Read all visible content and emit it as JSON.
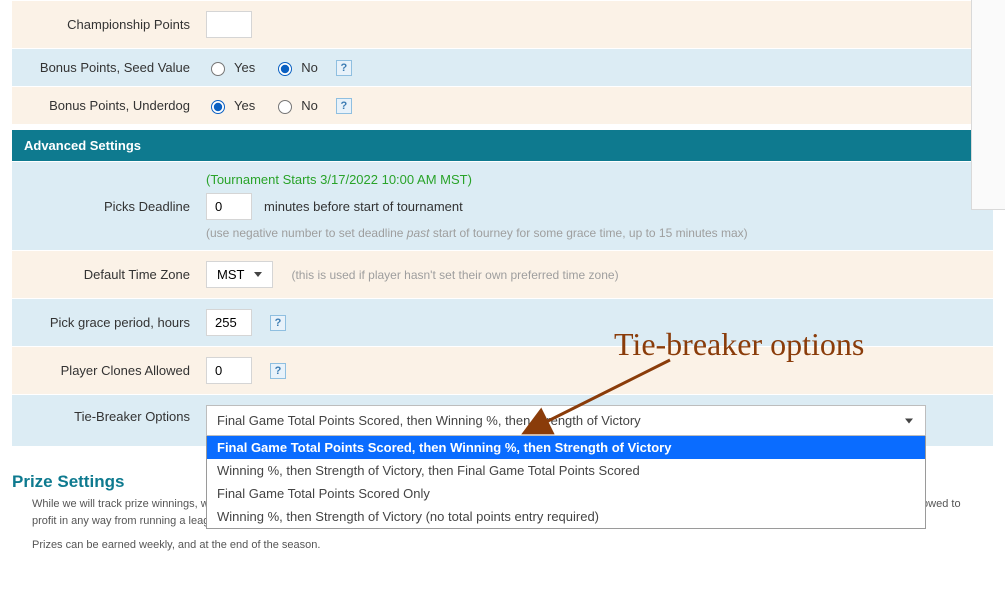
{
  "rows": {
    "championship_points": {
      "label": "Championship Points",
      "value": ""
    },
    "seed_bonus": {
      "label": "Bonus Points, Seed Value",
      "yes": "Yes",
      "no": "No"
    },
    "underdog_bonus": {
      "label": "Bonus Points, Underdog",
      "yes": "Yes",
      "no": "No"
    },
    "picks_deadline": {
      "label": "Picks Deadline",
      "note": "(Tournament Starts 3/17/2022 10:00 AM MST)",
      "value": "0",
      "suffix": "minutes before start of tournament",
      "hint_prefix": "(use negative number to set deadline ",
      "hint_em": "past",
      "hint_suffix": " start of tourney for some grace time, up to 15 minutes max)"
    },
    "default_tz": {
      "label": "Default Time Zone",
      "value": "MST",
      "hint": "(this is used if player hasn't set their own preferred time zone)"
    },
    "grace": {
      "label": "Pick grace period, hours",
      "value": "255"
    },
    "clones": {
      "label": "Player Clones Allowed",
      "value": "0"
    },
    "tiebreak": {
      "label": "Tie-Breaker Options",
      "selected": "Final Game Total Points Scored, then Winning %, then Strength of Victory",
      "options": [
        "Final Game Total Points Scored, then Winning %, then Strength of Victory",
        "Winning %, then Strength of Victory, then Final Game Total Points Scored",
        "Final Game Total Points Scored Only",
        "Winning %, then Strength of Victory (no total points entry required)"
      ]
    }
  },
  "section_advanced": "Advanced Settings",
  "prize": {
    "title": "Prize Settings",
    "line1": "While we will track prize winnings, we do not handle payment reception or distribution of prizes for your league. It is up to you to collect fees and pay the prize winners. You are NOT allowed to profit in any way from running a league.",
    "line2": "Prizes can be earned weekly, and at the end of the season."
  },
  "annotation": {
    "label": "Tie-breaker options"
  },
  "help_glyph": "?"
}
